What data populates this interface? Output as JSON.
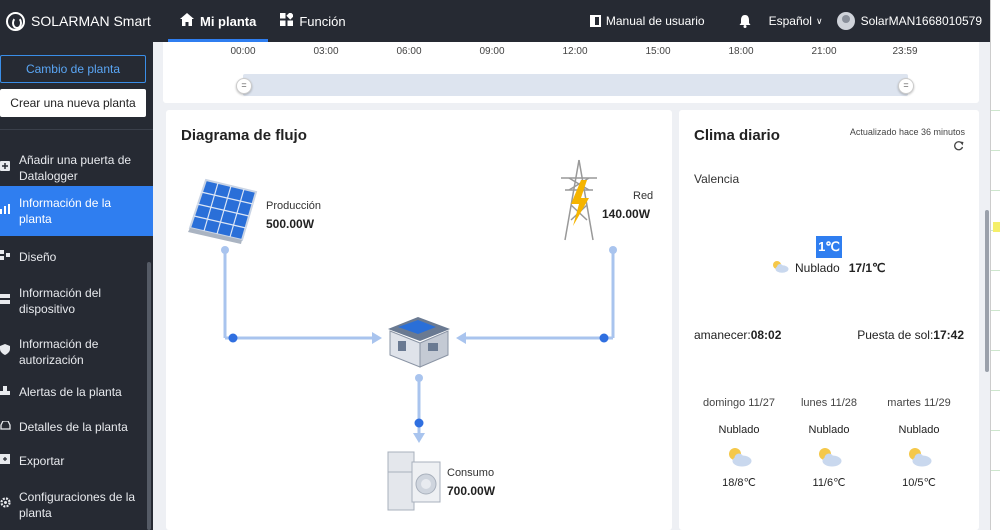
{
  "header": {
    "brand": "SOLARMAN Smart",
    "tabs": [
      {
        "label": "Mi planta",
        "icon": "home-icon",
        "active": true
      },
      {
        "label": "Función",
        "icon": "grid-icon",
        "active": false
      }
    ],
    "manual": "Manual de usuario",
    "language": "Español",
    "username": "SolarMAN1668010579"
  },
  "sidebar": {
    "change_plant": "Cambio de planta",
    "create_plant": "Crear una nueva planta",
    "items": [
      {
        "label1": "Añadir una puerta de",
        "label2": "Datalogger",
        "icon": "plus-square-icon",
        "active": false
      },
      {
        "label1": "Información de la",
        "label2": "planta",
        "icon": "chart-icon",
        "active": true
      },
      {
        "label1": "Diseño",
        "label2": "",
        "icon": "layout-icon",
        "active": false
      },
      {
        "label1": "Información del",
        "label2": "dispositivo",
        "icon": "device-icon",
        "active": false
      },
      {
        "label1": "Información de",
        "label2": "autorización",
        "icon": "shield-icon",
        "active": false
      },
      {
        "label1": "Alertas de la planta",
        "label2": "",
        "icon": "alert-icon",
        "active": false
      },
      {
        "label1": "Detalles de la planta",
        "label2": "",
        "icon": "car-icon",
        "active": false
      },
      {
        "label1": "Exportar",
        "label2": "",
        "icon": "export-icon",
        "active": false
      },
      {
        "label1": "Configuraciones de la",
        "label2": "planta",
        "icon": "gear-icon",
        "active": false
      }
    ]
  },
  "timeline": {
    "ticks": [
      "00:00",
      "03:00",
      "06:00",
      "09:00",
      "12:00",
      "15:00",
      "18:00",
      "21:00",
      "23:59"
    ]
  },
  "flow": {
    "title": "Diagrama de flujo",
    "production": {
      "label": "Producción",
      "value": "500.00W"
    },
    "grid": {
      "label": "Red",
      "value": "140.00W"
    },
    "consumption": {
      "label": "Consumo",
      "value": "700.00W"
    },
    "line_color": "#a9c4ee",
    "dot_color": "#2f6fe0"
  },
  "weather": {
    "title": "Clima diario",
    "updated": "Actualizado hace 36 minutos",
    "city": "Valencia",
    "current_temp": "1℃",
    "condition": "Nublado",
    "range": "17/1℃",
    "sunrise_label": "amanecer:",
    "sunrise": "08:02",
    "sunset_label": "Puesta de sol:",
    "sunset": "17:42",
    "forecast": [
      {
        "day": "domingo 11/27",
        "cond": "Nublado",
        "temp": "18/8℃"
      },
      {
        "day": "lunes 11/28",
        "cond": "Nublado",
        "temp": "11/6℃"
      },
      {
        "day": "martes 11/29",
        "cond": "Nublado",
        "temp": "10/5℃"
      }
    ]
  }
}
